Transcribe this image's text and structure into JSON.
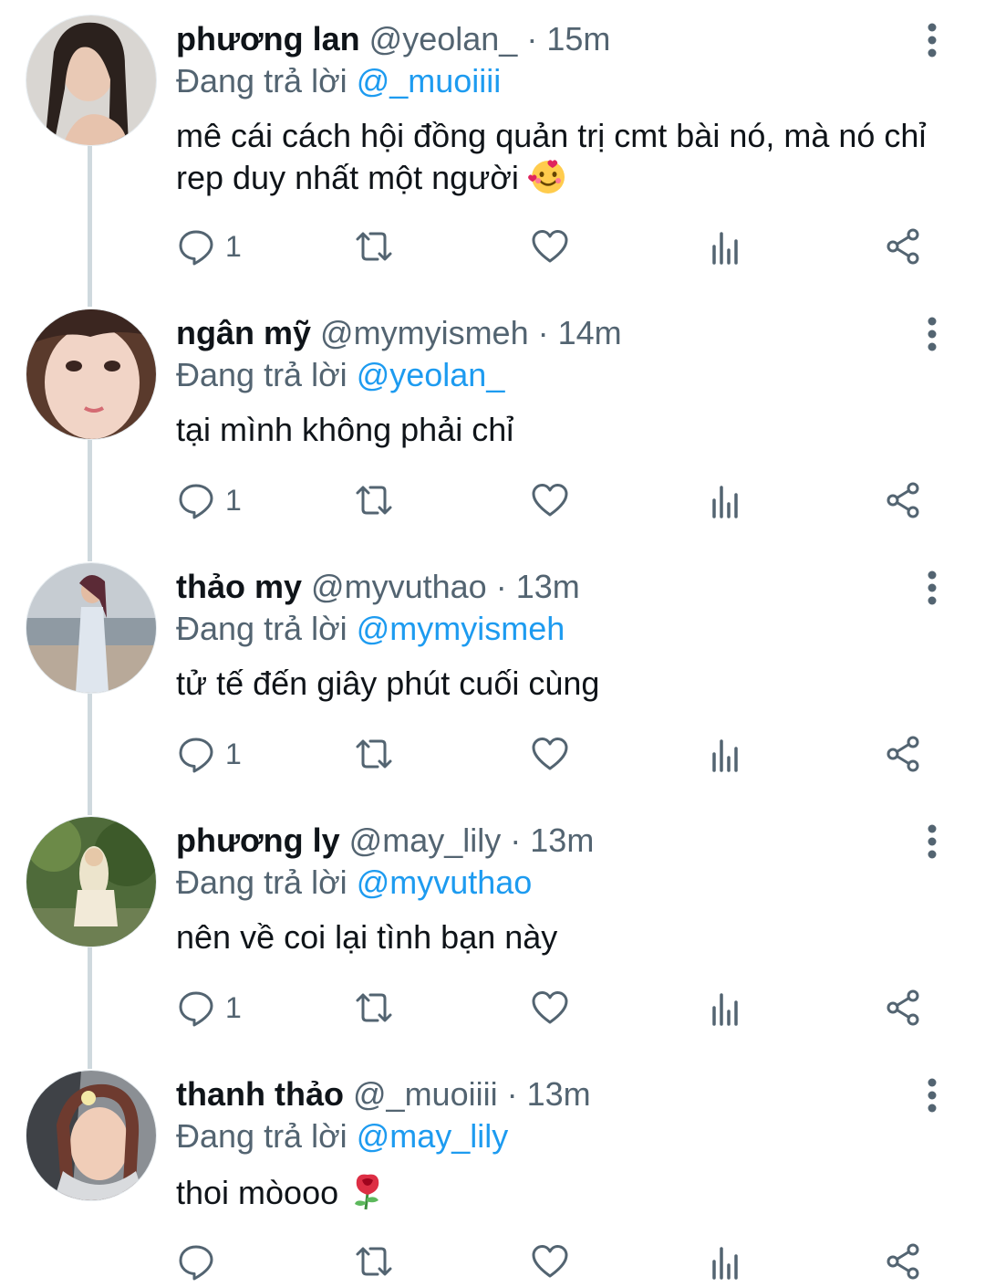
{
  "reply_prefix": "Đang trả lời",
  "tweets": [
    {
      "name": "phương lan",
      "handle": "@yeolan_",
      "separator": "·",
      "time": "15m",
      "reply_to": "@_muoiiii",
      "text": "mê cái cách hội đồng quản trị cmt bài nó, mà nó chỉ rep duy nhất một người",
      "emoji": "smiling-face-with-hearts",
      "reply_count": "1"
    },
    {
      "name": "ngân mỹ",
      "handle": "@mymyismeh",
      "separator": "·",
      "time": "14m",
      "reply_to": "@yeolan_",
      "text": "tại mình không phải chỉ",
      "reply_count": "1"
    },
    {
      "name": "thảo my",
      "handle": "@myvuthao",
      "separator": "·",
      "time": "13m",
      "reply_to": "@mymyismeh",
      "text": "tử tế đến giây phút cuối cùng",
      "reply_count": "1"
    },
    {
      "name": "phương ly",
      "handle": "@may_lily",
      "separator": "·",
      "time": "13m",
      "reply_to": "@myvuthao",
      "text": "nên về coi lại tình bạn này",
      "reply_count": "1"
    },
    {
      "name": "thanh thảo",
      "handle": "@_muoiiii",
      "separator": "·",
      "time": "13m",
      "reply_to": "@may_lily",
      "text": "thoi mòooo",
      "emoji": "rose",
      "reply_count": ""
    }
  ],
  "colors": {
    "accent": "#1d9bf0",
    "secondary_text": "#536471",
    "thread_line": "#cfd9de"
  }
}
